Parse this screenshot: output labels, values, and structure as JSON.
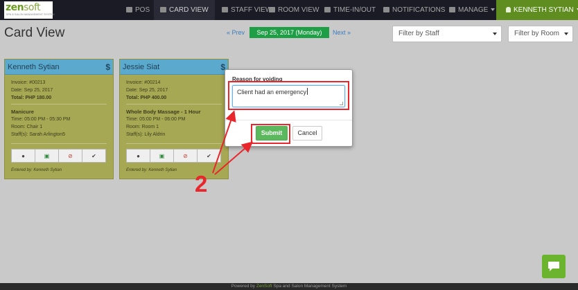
{
  "app": {
    "logo_main": "zen",
    "logo_accent": "soft",
    "logo_tagline": "SPA & SALON MANAGEMENT SYSTEM"
  },
  "nav": {
    "items": [
      {
        "label": "POS",
        "icon": "pos-icon"
      },
      {
        "label": "CARD VIEW",
        "icon": "card-view-icon"
      },
      {
        "label": "STAFF VIEW",
        "icon": "staff-view-icon"
      },
      {
        "label": "ROOM VIEW",
        "icon": "room-view-icon"
      },
      {
        "label": "TIME-IN/OUT",
        "icon": "clock-icon"
      },
      {
        "label": "NOTIFICATIONS",
        "icon": "bell-icon"
      },
      {
        "label": "MANAGE",
        "icon": "gear-icon"
      }
    ],
    "user": "KENNETH SYTIAN"
  },
  "page": {
    "title": "Card View",
    "prev": "« Prev",
    "date": "Sep 25, 2017 (Monday)",
    "next": "Next »",
    "filter_staff": "Filter by Staff",
    "filter_room": "Filter by Room"
  },
  "cards": [
    {
      "name": "Kenneth Sytian",
      "currency_symbol": "$",
      "invoice": "Invoice: #00213",
      "date": "Date: Sep 25, 2017",
      "total": "Total: PHP 180.00",
      "service": "Manicure",
      "time": "Time: 05:00 PM - 05:30 PM",
      "room": "Room: Chair 1",
      "staff": "Staff(s): Sarah Arlington5",
      "entered_by": "Entered by: Kenneth Sytian"
    },
    {
      "name": "Jessie Siat",
      "currency_symbol": "$",
      "invoice": "Invoice: #00214",
      "date": "Date: Sep 25, 2017",
      "total": "Total: PHP 400.00",
      "service": "Whole Body Massage - 1 Hour",
      "time": "Time: 05:00 PM - 06:00 PM",
      "room": "Room: Room 1",
      "staff": "Staff(s): Lily Aldrin",
      "entered_by": "Entered by: Kenneth Sytian"
    }
  ],
  "modal": {
    "label": "Reason for voiding",
    "value": "Client had an emergency",
    "submit": "Submit",
    "cancel": "Cancel"
  },
  "annotation": {
    "number": "2",
    "color": "#e8262b"
  },
  "footer": {
    "prefix": "Powered by ",
    "brand": "ZenSoft",
    "suffix": " Spa and Salon Management System"
  },
  "colors": {
    "nav_bg": "#1b1b26",
    "user_bg": "#5f8d1f",
    "date_badge": "#1e9e45",
    "card_bg": "#a7a853",
    "card_head": "#5ba9cd",
    "submit": "#5cb85c"
  }
}
